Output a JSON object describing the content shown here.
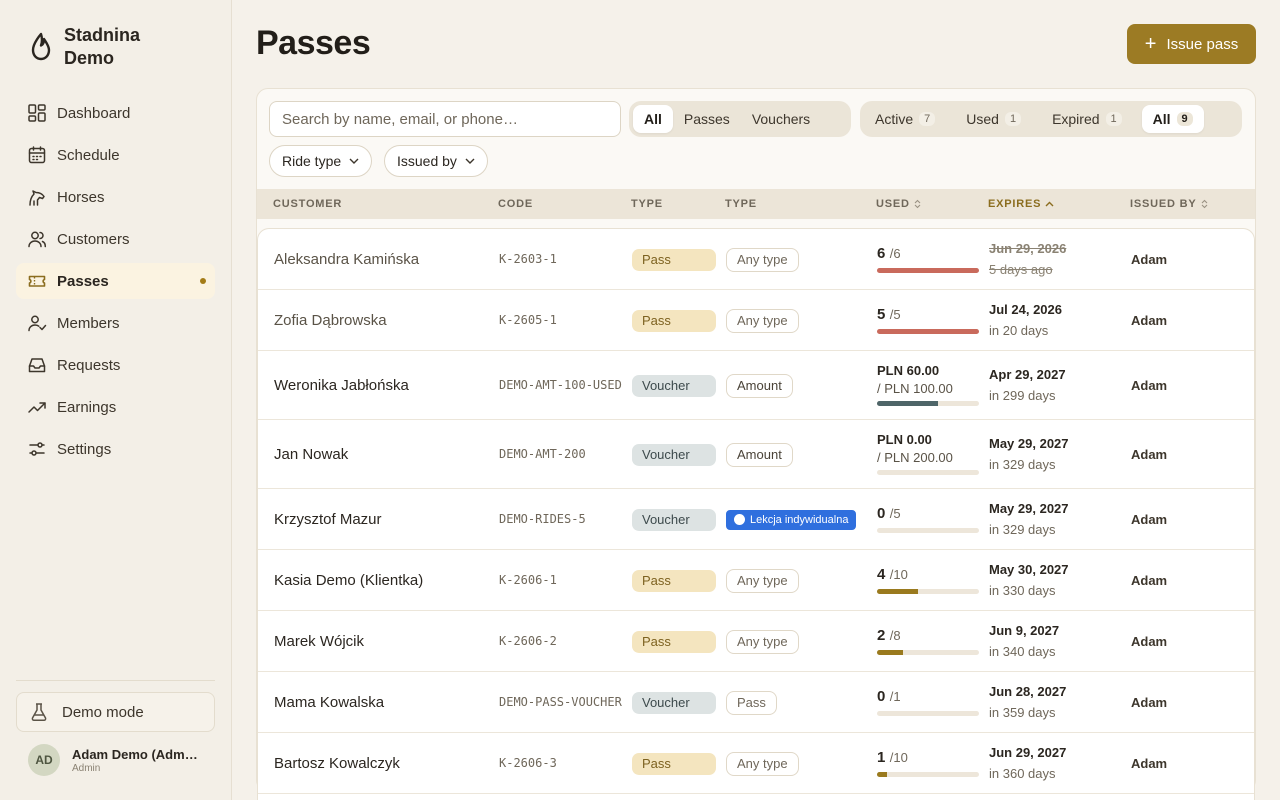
{
  "brand": {
    "name": "Stadnina Demo"
  },
  "nav": [
    {
      "label": "Dashboard",
      "icon": "dashboard-icon"
    },
    {
      "label": "Schedule",
      "icon": "calendar-icon"
    },
    {
      "label": "Horses",
      "icon": "horse-icon"
    },
    {
      "label": "Customers",
      "icon": "users-icon"
    },
    {
      "label": "Passes",
      "icon": "ticket-icon",
      "active": true
    },
    {
      "label": "Members",
      "icon": "member-icon"
    },
    {
      "label": "Requests",
      "icon": "inbox-icon"
    },
    {
      "label": "Earnings",
      "icon": "trend-icon"
    },
    {
      "label": "Settings",
      "icon": "sliders-icon"
    }
  ],
  "demo_mode": {
    "label": "Demo mode"
  },
  "user": {
    "initials": "AD",
    "name": "Adam Demo (Admin)",
    "role": "Admin"
  },
  "page": {
    "title": "Passes",
    "issue_label": "Issue pass"
  },
  "search": {
    "placeholder": "Search by name, email, or phone…"
  },
  "type_tabs": [
    {
      "label": "All",
      "active": true
    },
    {
      "label": "Passes"
    },
    {
      "label": "Vouchers"
    }
  ],
  "status_tabs": [
    {
      "label": "Active",
      "count": "7"
    },
    {
      "label": "Used",
      "count": "1"
    },
    {
      "label": "Expired",
      "count": "1"
    },
    {
      "label": "All",
      "count": "9",
      "active": true
    }
  ],
  "filters": {
    "ride_type": "Ride type",
    "issued_by": "Issued by"
  },
  "columns": {
    "customer": "CUSTOMER",
    "code": "CODE",
    "type": "TYPE",
    "type2": "TYPE",
    "used": "USED",
    "expires": "EXPIRES",
    "issued_by": "ISSUED BY"
  },
  "colors": {
    "accent": "#9c7b24",
    "bar_full": "#c96a5c",
    "bar_pass": "#9a7a1e",
    "bar_voucher": "#4e6568",
    "lesson_tag": "#2f6fde"
  },
  "rows": [
    {
      "customer": "Aleksandra Kamińska",
      "code": "K-2603-1",
      "kind": "Pass",
      "scope": "Any type",
      "used": "6",
      "total": "/6",
      "fill": 1.0,
      "expires": "Jun 29, 2026",
      "relative": "5 days ago",
      "expired": true,
      "issued_by": "Adam"
    },
    {
      "customer": "Zofia Dąbrowska",
      "code": "K-2605-1",
      "kind": "Pass",
      "scope": "Any type",
      "used": "5",
      "total": "/5",
      "fill": 1.0,
      "expires": "Jul 24, 2026",
      "relative": "in 20 days",
      "issued_by": "Adam"
    },
    {
      "customer": "Weronika Jabłońska",
      "code": "DEMO-AMT-100-USED",
      "kind": "Voucher",
      "scope": "Amount",
      "money_used": "PLN 60.00",
      "money_total": "/ PLN 100.00",
      "fill": 0.6,
      "expires": "Apr 29, 2027",
      "relative": "in 299 days",
      "issued_by": "Adam"
    },
    {
      "customer": "Jan Nowak",
      "code": "DEMO-AMT-200",
      "kind": "Voucher",
      "scope": "Amount",
      "money_used": "PLN 0.00",
      "money_total": "/ PLN 200.00",
      "fill": 0.0,
      "expires": "May 29, 2027",
      "relative": "in 329 days",
      "issued_by": "Adam"
    },
    {
      "customer": "Krzysztof Mazur",
      "code": "DEMO-RIDES-5",
      "kind": "Voucher",
      "scope": "Lekcja indywidualna",
      "scope_style": "lesson",
      "used": "0",
      "total": "/5",
      "fill": 0.0,
      "expires": "May 29, 2027",
      "relative": "in 329 days",
      "issued_by": "Adam"
    },
    {
      "customer": "Kasia Demo (Klientka)",
      "code": "K-2606-1",
      "kind": "Pass",
      "scope": "Any type",
      "used": "4",
      "total": "/10",
      "fill": 0.4,
      "expires": "May 30, 2027",
      "relative": "in 330 days",
      "issued_by": "Adam"
    },
    {
      "customer": "Marek Wójcik",
      "code": "K-2606-2",
      "kind": "Pass",
      "scope": "Any type",
      "used": "2",
      "total": "/8",
      "fill": 0.25,
      "expires": "Jun 9, 2027",
      "relative": "in 340 days",
      "issued_by": "Adam"
    },
    {
      "customer": "Mama Kowalska",
      "code": "DEMO-PASS-VOUCHER",
      "kind": "Voucher",
      "scope": "Pass",
      "used": "0",
      "total": "/1",
      "fill": 0.0,
      "expires": "Jun 28, 2027",
      "relative": "in 359 days",
      "issued_by": "Adam"
    },
    {
      "customer": "Bartosz Kowalczyk",
      "code": "K-2606-3",
      "kind": "Pass",
      "scope": "Any type",
      "used": "1",
      "total": "/10",
      "fill": 0.1,
      "expires": "Jun 29, 2027",
      "relative": "in 360 days",
      "issued_by": "Adam"
    }
  ]
}
